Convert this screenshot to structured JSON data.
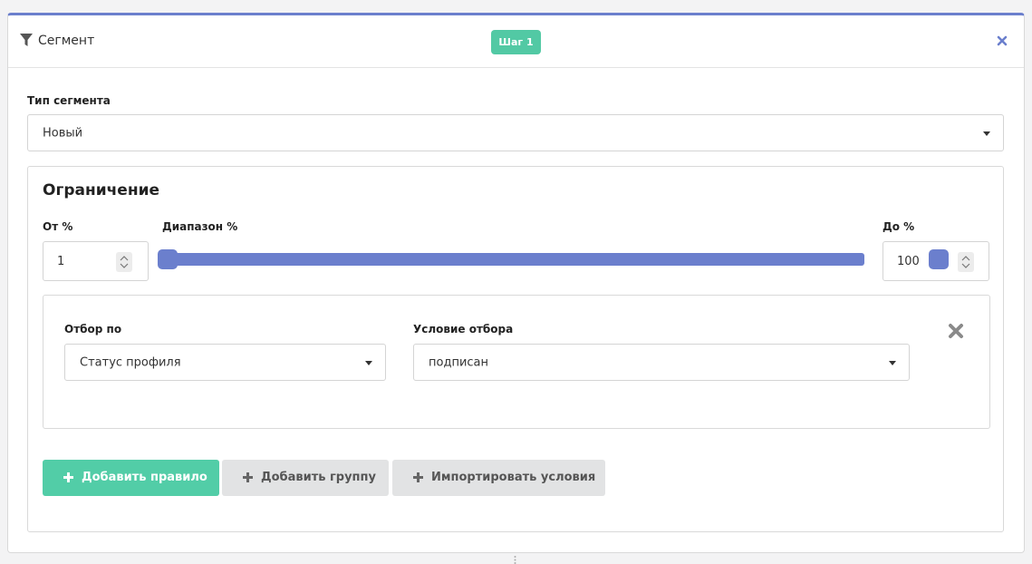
{
  "header": {
    "title": "Сегмент",
    "step_badge": "Шаг 1",
    "filter_icon": "filter-icon",
    "close_icon": "close-icon"
  },
  "segment_type": {
    "label": "Тип сегмента",
    "value": "Новый"
  },
  "limit": {
    "title": "Ограничение",
    "from_label": "От %",
    "from_value": "1",
    "range_label": "Диапазон %",
    "range_min": 1,
    "range_max": 100,
    "to_label": "До %",
    "to_value": "100"
  },
  "rule": {
    "field_label": "Отбор по",
    "field_value": "Статус профиля",
    "condition_label": "Условие отбора",
    "condition_value": "подписан",
    "remove_icon": "remove-icon"
  },
  "buttons": {
    "add_rule": "Добавить правило",
    "add_group": "Добавить группу",
    "import_conditions": "Импортировать условия"
  },
  "colors": {
    "accent": "#6b7fcd",
    "badge": "#52c9a4",
    "primary_button": "#52cda7",
    "secondary_button": "#e2e3e4"
  }
}
